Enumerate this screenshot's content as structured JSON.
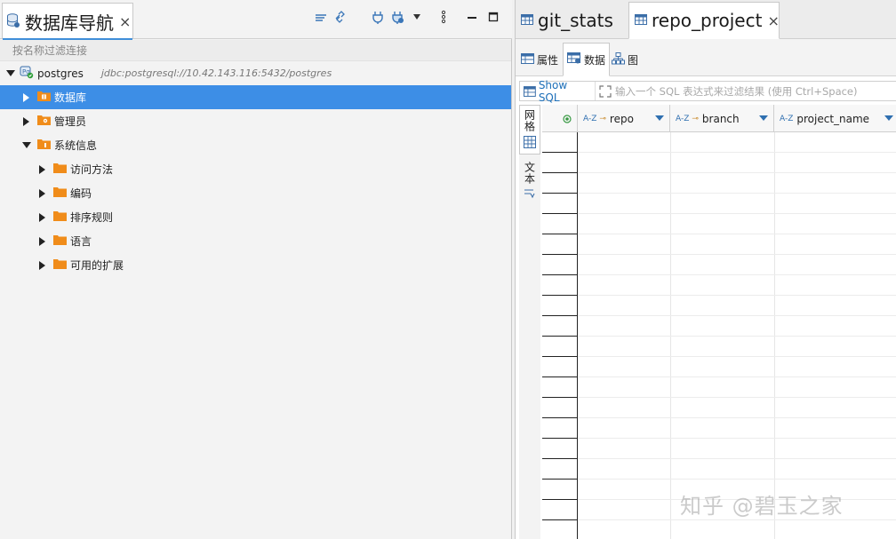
{
  "navigator": {
    "title": "数据库导航",
    "filter_placeholder": "按名称过滤连接",
    "connection": {
      "name": "postgres",
      "url": "jdbc:postgresql://10.42.143.116:5432/postgres"
    },
    "items": [
      {
        "label": "数据库"
      },
      {
        "label": "管理员"
      },
      {
        "label": "系统信息"
      }
    ],
    "system_children": [
      {
        "label": "访问方法"
      },
      {
        "label": "编码"
      },
      {
        "label": "排序规则"
      },
      {
        "label": "语言"
      },
      {
        "label": "可用的扩展"
      }
    ]
  },
  "editor": {
    "tabs": [
      {
        "label": "git_stats"
      },
      {
        "label": "repo_project"
      }
    ],
    "subtabs": [
      {
        "label": "属性"
      },
      {
        "label": "数据"
      },
      {
        "label": "图"
      }
    ],
    "show_sql_label": "Show SQL",
    "filter_placeholder": "输入一个 SQL 表达式来过滤结果 (使用 Ctrl+Space)",
    "side_tabs": [
      {
        "label": "网格"
      },
      {
        "label": "文本"
      }
    ],
    "columns": [
      {
        "type_tag": "A-Z",
        "name": "repo"
      },
      {
        "type_tag": "A-Z",
        "name": "branch"
      },
      {
        "type_tag": "A-Z",
        "name": "project_name"
      }
    ]
  },
  "watermark": "知乎 @碧玉之家",
  "colors": {
    "selection": "#3d8ee6",
    "accent": "#3f8ed9",
    "folder": "#f08c1a"
  }
}
